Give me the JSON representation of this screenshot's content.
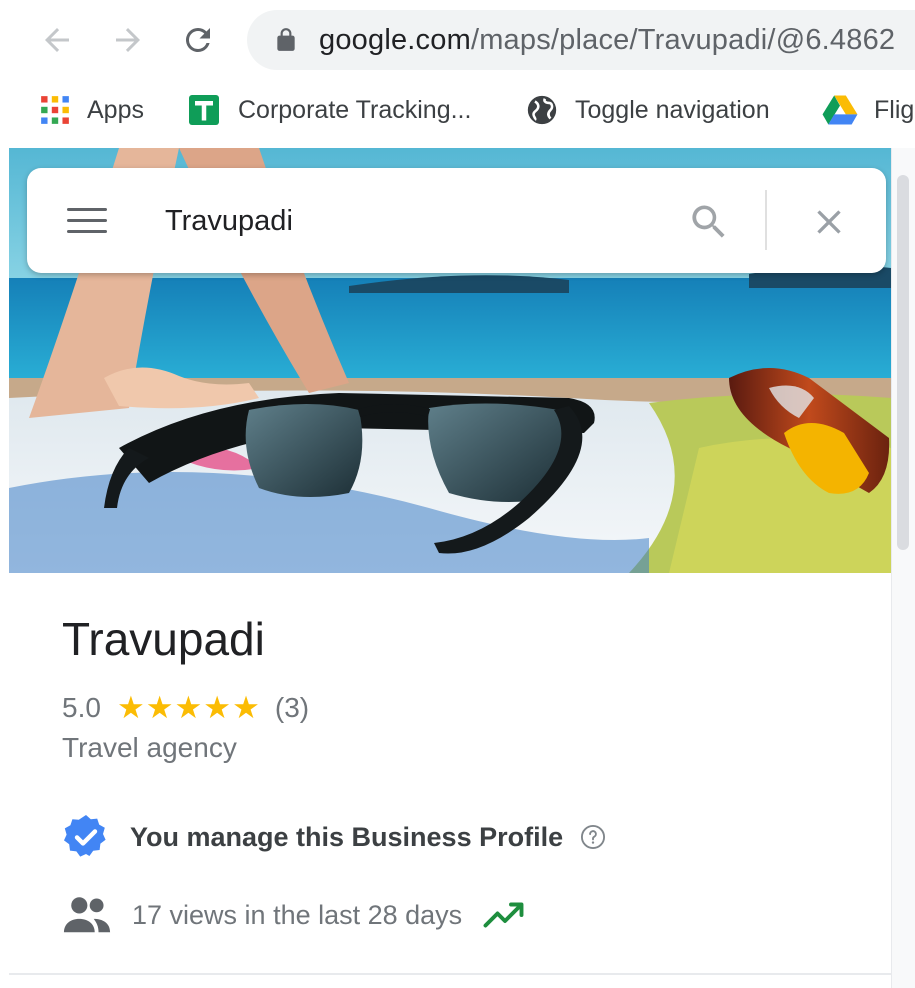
{
  "browser": {
    "url_host": "google.com",
    "url_path": "/maps/place/Travupadi/@6.4862"
  },
  "bookmarks": [
    {
      "label": "Apps",
      "icon": "apps-grid-icon"
    },
    {
      "label": "Corporate Tracking...",
      "icon": "sheets-icon"
    },
    {
      "label": "Toggle navigation",
      "icon": "globe-icon"
    },
    {
      "label": "Flig",
      "icon": "drive-icon"
    }
  ],
  "search": {
    "value": "Travupadi"
  },
  "place": {
    "name": "Travupadi",
    "rating": "5.0",
    "stars": "★★★★★",
    "stars_value": 5,
    "review_count": "(3)",
    "category": "Travel agency",
    "manage_text": "You manage this Business Profile",
    "views_text": "17 views in the last 28 days"
  },
  "colors": {
    "star": "#fbbc04",
    "verified": "#4285f4",
    "trend": "#1e8e3e"
  }
}
